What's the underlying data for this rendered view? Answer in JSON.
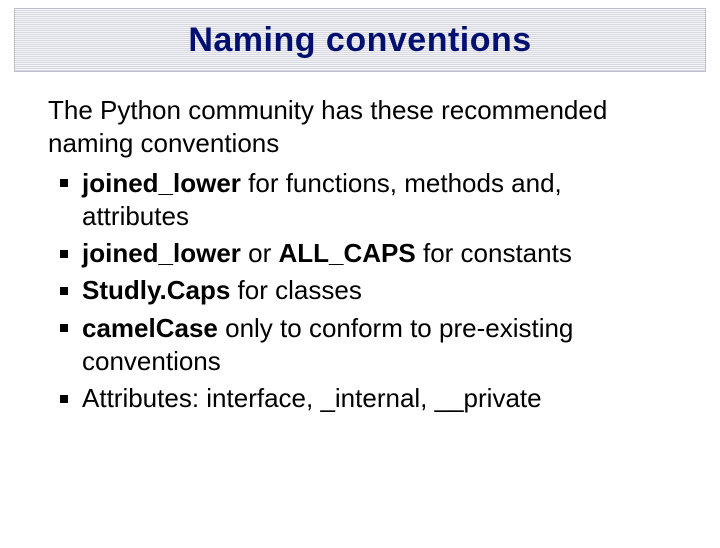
{
  "title": "Naming conventions",
  "intro": "The Python community has these recommended naming conventions",
  "items": {
    "i0": {
      "s0": "joined_lower",
      "s1": " for functions, methods and, attributes"
    },
    "i1": {
      "s0": "joined_lower",
      "s1": " or ",
      "s2": "ALL_CAPS",
      "s3": " for constants"
    },
    "i2": {
      "s0": "Studly.Caps",
      "s1": " for classes"
    },
    "i3": {
      "s0": "camelCase",
      "s1": " only to conform to pre-existing conventions"
    },
    "i4": {
      "s0": "Attributes: interface, _internal, __private"
    }
  }
}
